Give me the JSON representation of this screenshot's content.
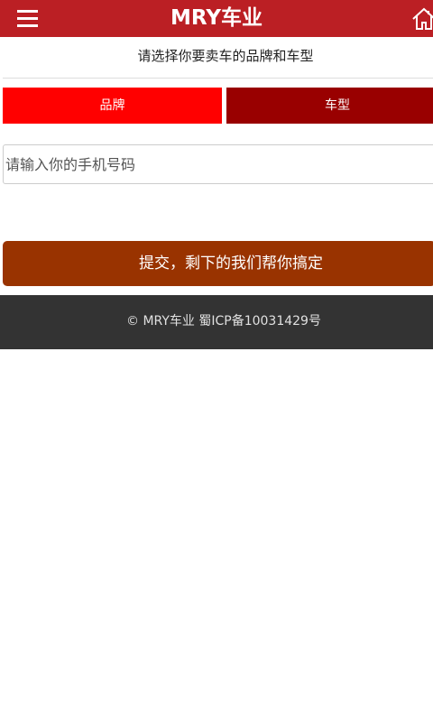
{
  "header": {
    "logo_text": "MRY车业",
    "menu_icon": "hamburger-menu-icon",
    "home_icon": "home-icon",
    "background_color": "#bb1f24"
  },
  "form": {
    "instruction": "请选择你要卖车的品牌和车型",
    "tabs": [
      {
        "label": "品牌",
        "color": "#ff0000"
      },
      {
        "label": "车型",
        "color": "#990000"
      }
    ],
    "phone_placeholder": "请输入你的手机号码",
    "phone_value": "",
    "submit_label": "提交，剩下的我们帮你搞定",
    "submit_color": "#993300"
  },
  "footer": {
    "text": "© MRY车业 蜀ICP备10031429号",
    "background_color": "#333333"
  }
}
